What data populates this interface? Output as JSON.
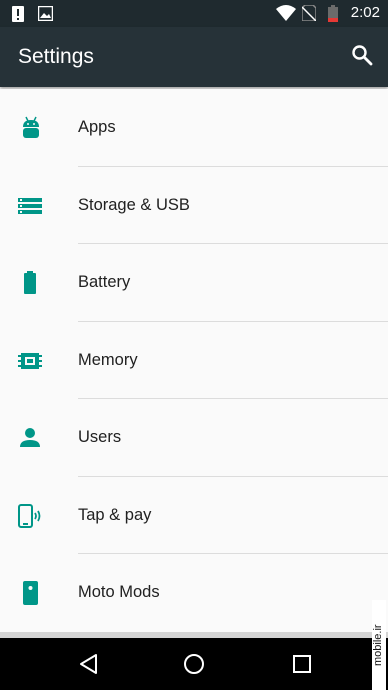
{
  "status_bar": {
    "time": "2:02",
    "icons": [
      "alert-icon",
      "image-icon",
      "wifi-icon",
      "no-sim-icon",
      "battery-low-icon"
    ]
  },
  "app_bar": {
    "title": "Settings",
    "search_icon": "search-icon"
  },
  "settings_items": [
    {
      "label": "Apps",
      "icon": "android-icon"
    },
    {
      "label": "Storage & USB",
      "icon": "storage-icon"
    },
    {
      "label": "Battery",
      "icon": "battery-icon"
    },
    {
      "label": "Memory",
      "icon": "memory-chip-icon"
    },
    {
      "label": "Users",
      "icon": "person-icon"
    },
    {
      "label": "Tap & pay",
      "icon": "tap-pay-icon"
    },
    {
      "label": "Moto Mods",
      "icon": "moto-mods-icon"
    }
  ],
  "nav_bar": {
    "buttons": [
      "back-icon",
      "home-icon",
      "recents-icon"
    ]
  },
  "watermark": {
    "text": "mobile.ir"
  },
  "colors": {
    "accent": "#009688",
    "app_bar": "#263238",
    "status_bar": "#1f2a2f"
  }
}
